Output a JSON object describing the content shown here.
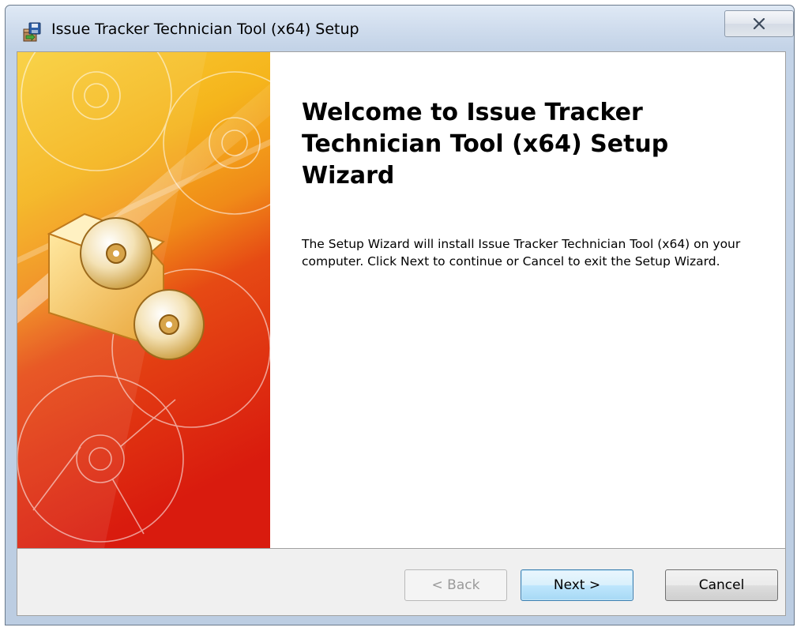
{
  "window": {
    "title": "Issue Tracker Technician Tool (x64) Setup",
    "icon": "installer-icon"
  },
  "main": {
    "heading": "Welcome to Issue Tracker Technician Tool (x64) Setup Wizard",
    "description": "The Setup Wizard will install Issue Tracker Technician Tool (x64) on your computer.  Click Next to continue or Cancel to exit the Setup Wizard."
  },
  "buttons": {
    "back": "< Back",
    "next": "Next >",
    "cancel": "Cancel",
    "back_enabled": false
  },
  "colors": {
    "banner_top": "#f6b80a",
    "banner_bottom": "#d9200f",
    "accent": "#3c7fb1"
  }
}
